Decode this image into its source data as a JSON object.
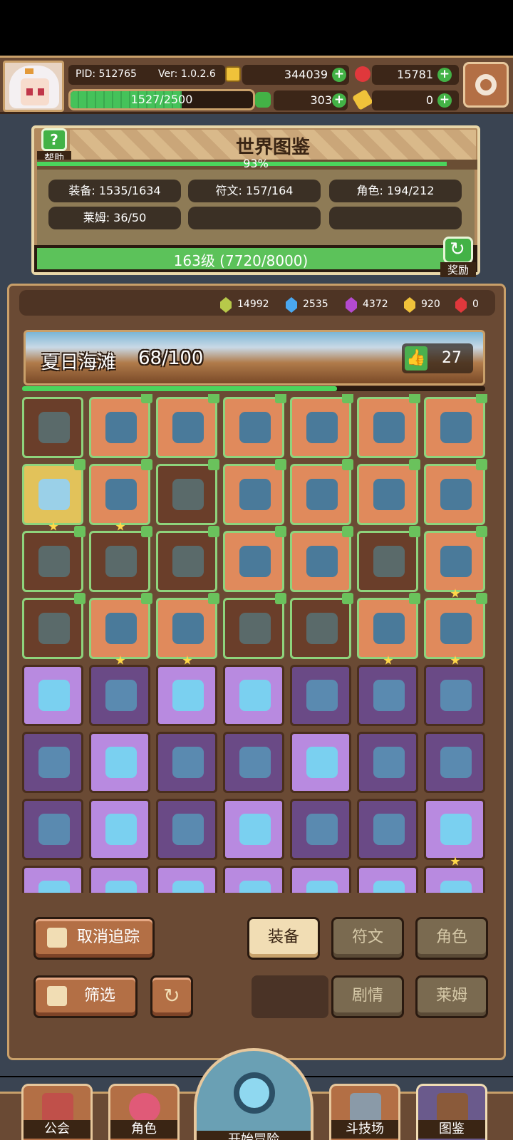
{
  "header": {
    "pid": "PID: 512765",
    "version": "Ver: 1.0.2.6",
    "gold": "344039",
    "ruby": "15781",
    "xp": "1527/2500",
    "xp_fraction": 0.61,
    "clover": "303",
    "key": "0"
  },
  "encyclopedia": {
    "help_label": "帮助",
    "title": "世界图鉴",
    "percent": "93%",
    "percent_value": 0.93,
    "stats": {
      "equipment": "装备: 1535/1634",
      "rune": "符文: 157/164",
      "character": "角色: 194/212",
      "slime": "莱姆: 36/50"
    },
    "level_text": "163级 (7720/8000)",
    "level_fraction": 0.965,
    "reward_label": "奖励"
  },
  "gems": [
    {
      "color": "#b7c94a",
      "value": "14992"
    },
    {
      "color": "#4aa8f0",
      "value": "2535"
    },
    {
      "color": "#b44ad0",
      "value": "4372"
    },
    {
      "color": "#f0c23a",
      "value": "920"
    },
    {
      "color": "#e0383c",
      "value": "0"
    }
  ],
  "area": {
    "name": "夏日海滩",
    "progress": "68/100",
    "progress_fraction": 0.68,
    "likes": "27"
  },
  "colors": {
    "common_cell": "#6a3e2a",
    "orange_cell": "#e08a5c",
    "gold_cell": "#e2c25a",
    "purple_cell": "#6a4a86",
    "light_purple_cell": "#b88ae0"
  },
  "controls": {
    "untrack": "取消追踪",
    "filter": "筛选",
    "tab_equipment": "装备",
    "tab_rune": "符文",
    "tab_character": "角色",
    "tab_story": "剧情",
    "tab_slime": "莱姆"
  },
  "nav": {
    "guild": "公会",
    "character": "角色",
    "adventure": "开始冒险",
    "arena": "斗技场",
    "encyclopedia": "图鉴"
  }
}
